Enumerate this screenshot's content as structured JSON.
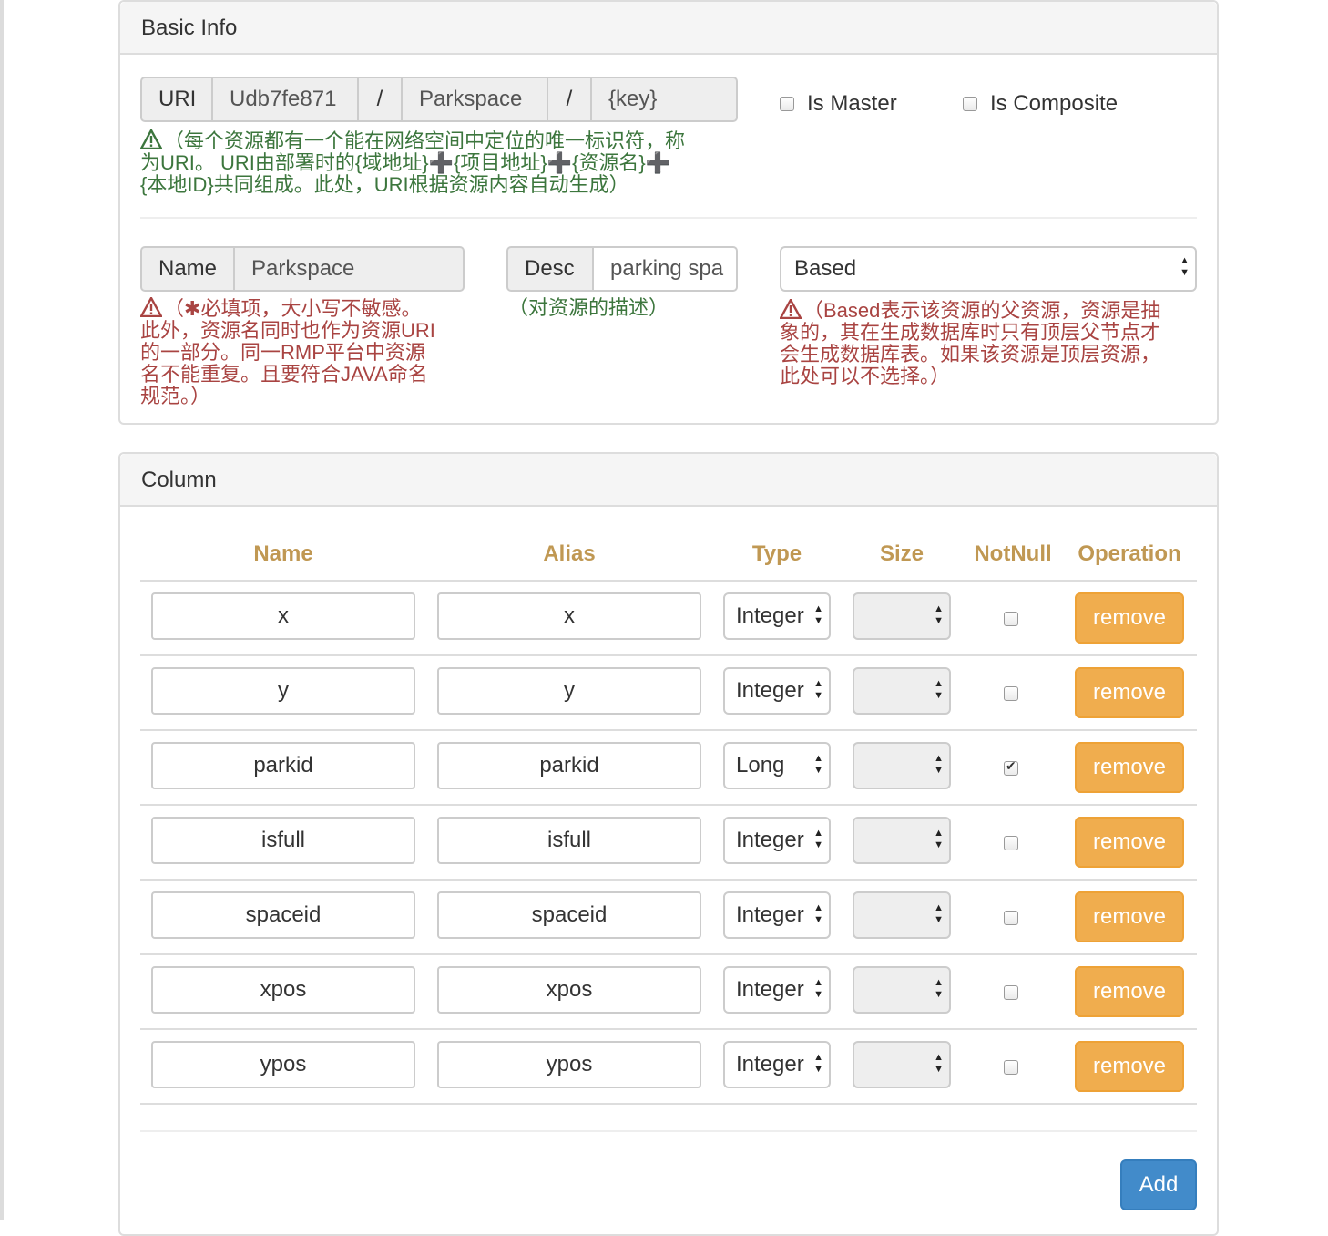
{
  "basic_info": {
    "title": "Basic Info",
    "uri": {
      "label": "URI",
      "domain_value": "Udb7fe871",
      "sep1": "/",
      "project_value": "Parkspace",
      "sep2": "/",
      "key_value": "{key}"
    },
    "uri_hint": [
      "（每个资源都有一个能在网络空间中定位的唯一标识符，称",
      "为URI。  URI由部署时的{域地址}➕{项目地址}➕{资源名}➕",
      "{本地ID}共同组成。此处，URI根据资源内容自动生成）"
    ],
    "is_master_label": "Is Master",
    "is_master_checked": false,
    "is_composite_label": "Is Composite",
    "is_composite_checked": false,
    "name": {
      "label": "Name",
      "value": "Parkspace"
    },
    "name_hint": [
      "（",
      "必填项，大小写不敏感。",
      "此外，资源名同时也作为资源URI",
      "的一部分。同一RMP平台中资源",
      "名不能重复。且要符合JAVA命名",
      "规范。）"
    ],
    "desc": {
      "label": "Desc",
      "value": "parking spa"
    },
    "desc_hint": "（对资源的描述）",
    "based": {
      "value": "Based"
    },
    "based_hint": [
      "（Based表示该资源的父资源，资源是抽",
      "象的，其在生成数据库时只有顶层父节点才",
      "会生成数据库表。如果该资源是顶层资源，",
      "此处可以不选择。）"
    ]
  },
  "column": {
    "title": "Column",
    "headers": {
      "name": "Name",
      "alias": "Alias",
      "type": "Type",
      "size": "Size",
      "notnull": "NotNull",
      "operation": "Operation"
    },
    "rows": [
      {
        "name": "x",
        "alias": "x",
        "type": "Integer",
        "size": "",
        "notnull": false,
        "action": "remove"
      },
      {
        "name": "y",
        "alias": "y",
        "type": "Integer",
        "size": "",
        "notnull": false,
        "action": "remove"
      },
      {
        "name": "parkid",
        "alias": "parkid",
        "type": "Long",
        "size": "",
        "notnull": true,
        "action": "remove"
      },
      {
        "name": "isfull",
        "alias": "isfull",
        "type": "Integer",
        "size": "",
        "notnull": false,
        "action": "remove"
      },
      {
        "name": "spaceid",
        "alias": "spaceid",
        "type": "Integer",
        "size": "",
        "notnull": false,
        "action": "remove"
      },
      {
        "name": "xpos",
        "alias": "xpos",
        "type": "Integer",
        "size": "",
        "notnull": false,
        "action": "remove"
      },
      {
        "name": "ypos",
        "alias": "ypos",
        "type": "Integer",
        "size": "",
        "notnull": false,
        "action": "remove"
      }
    ],
    "add_label": "Add"
  },
  "colors": {
    "warning_text": "#c09853",
    "btn_remove": "#f0ad4e",
    "btn_add": "#428bca",
    "hint_green": "#3c763d",
    "hint_red": "#a94442"
  }
}
